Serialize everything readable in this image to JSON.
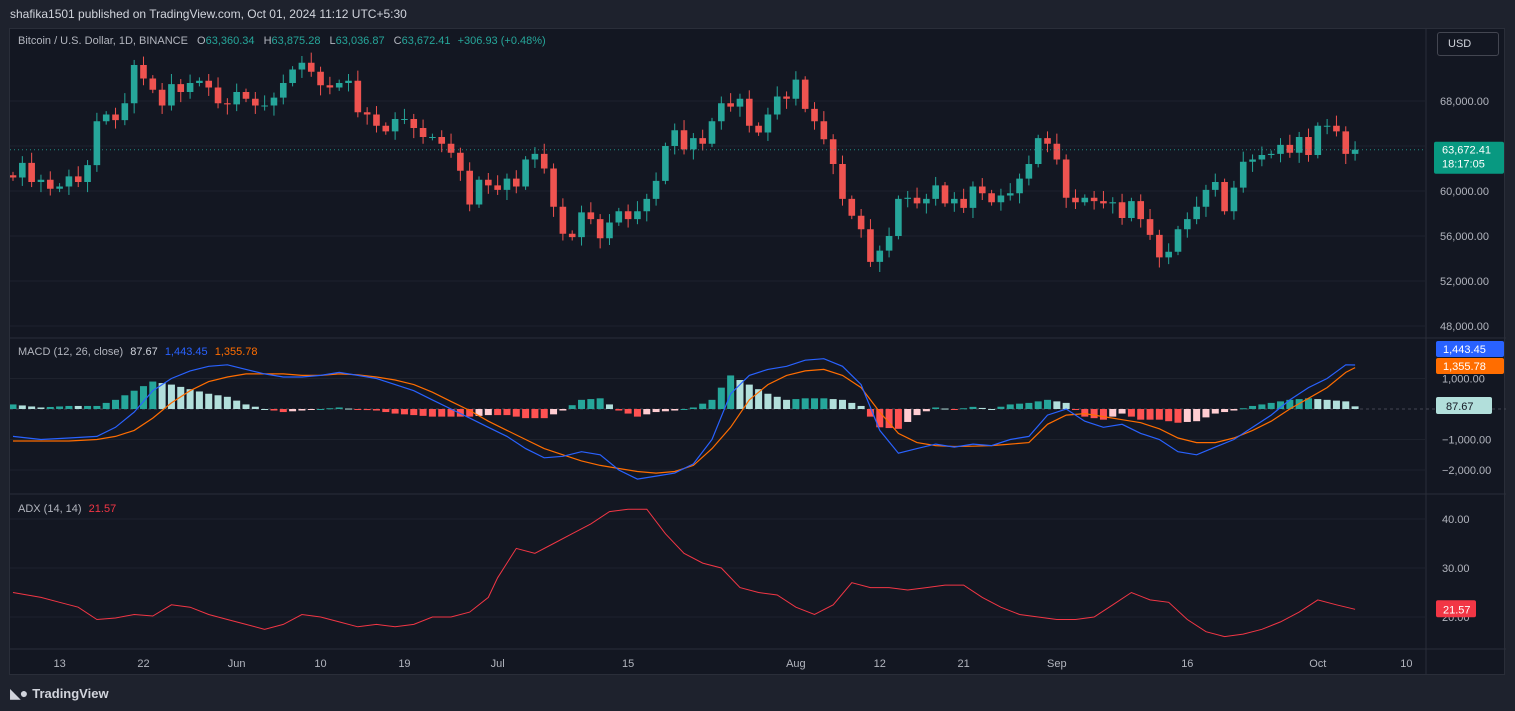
{
  "header": {
    "published_line": "shafika1501 published on TradingView.com, Oct 01, 2024 11:12 UTC+5:30"
  },
  "legend": {
    "symbol": "Bitcoin / U.S. Dollar, 1D, BINANCE",
    "open_label": "O",
    "open": "63,360.34",
    "high_label": "H",
    "high": "63,875.28",
    "low_label": "L",
    "low": "63,036.87",
    "close_label": "C",
    "close": "63,672.41",
    "change": "+306.93 (+0.48%)"
  },
  "currency_button": "USD",
  "price_axis": {
    "ticks": [
      "68,000.00",
      "64,000.00",
      "60,000.00",
      "56,000.00",
      "52,000.00",
      "48,000.00"
    ],
    "last_price": "63,672.41",
    "countdown": "18:17:05",
    "last_price_color": "#089981"
  },
  "macd": {
    "label": "MACD (12, 26, close)",
    "histogram": "87.67",
    "macd": "1,443.45",
    "signal": "1,355.78",
    "ticks": [
      "1,000.00",
      "0.00",
      "−1,000.00",
      "−2,000.00"
    ],
    "macd_color": "#2962ff",
    "signal_color": "#ff6d00"
  },
  "adx": {
    "label": "ADX (14, 14)",
    "value": "21.57",
    "ticks": [
      "40.00",
      "30.00",
      "20.00"
    ],
    "color": "#f23645"
  },
  "time_axis": {
    "labels": [
      "13",
      "22",
      "Jun",
      "10",
      "19",
      "Jul",
      "15",
      "Aug",
      "12",
      "21",
      "Sep",
      "16",
      "Oct",
      "10"
    ]
  },
  "colors": {
    "up": "#26a69a",
    "down": "#ef5350",
    "background": "#131722"
  },
  "footer": {
    "brand": "TradingView",
    "logo_icon": "tradingview-logo-icon"
  },
  "chart_data": [
    {
      "type": "candlestick",
      "title": "Bitcoin / U.S. Dollar, 1D, BINANCE",
      "ylim": [
        46000,
        72000
      ],
      "closes": [
        61200,
        62500,
        60800,
        61000,
        60200,
        60400,
        61300,
        60800,
        62300,
        66200,
        66800,
        66300,
        67800,
        71200,
        70000,
        69000,
        67600,
        69500,
        68800,
        69600,
        69800,
        69200,
        67800,
        67700,
        68800,
        68200,
        67600,
        67600,
        68300,
        69600,
        70800,
        71400,
        70600,
        69400,
        69200,
        69600,
        69800,
        67000,
        66800,
        65800,
        65300,
        66400,
        66400,
        65600,
        64800,
        64800,
        64200,
        63400,
        61800,
        58800,
        61000,
        60500,
        60100,
        61100,
        60400,
        62800,
        63300,
        62000,
        58600,
        56200,
        55900,
        58100,
        57500,
        55800,
        57200,
        58200,
        57500,
        58200,
        59300,
        60900,
        64000,
        65400,
        63700,
        64700,
        64200,
        66200,
        67800,
        67500,
        68200,
        65800,
        65200,
        66800,
        68400,
        68200,
        69900,
        67300,
        66200,
        64600,
        62400,
        59300,
        57800,
        56600,
        53700,
        54700,
        56000,
        59300,
        59400,
        58900,
        59300,
        60500,
        58900,
        59300,
        58500,
        60400,
        59800,
        59000,
        59600,
        59800,
        61100,
        62400,
        64700,
        64200,
        62800,
        59400,
        59000,
        59400,
        59100,
        58900,
        59000,
        57600,
        59100,
        57500,
        56100,
        54100,
        54600,
        56600,
        57500,
        58600,
        60100,
        60800,
        58200,
        60300,
        62600,
        62800,
        63200,
        63300,
        64100,
        63400,
        64800,
        63200,
        65800,
        65800,
        65300,
        63300,
        63672
      ]
    },
    {
      "type": "line",
      "title": "MACD (12, 26, close)",
      "ylim": [
        -2900,
        2000
      ],
      "series": [
        {
          "name": "MACD",
          "x": [
            0,
            3,
            6,
            9,
            11,
            13,
            15,
            17,
            19,
            21,
            23,
            25,
            27,
            29,
            31,
            33,
            35,
            37,
            39,
            41,
            43,
            45,
            47,
            49,
            51,
            53,
            55,
            57,
            59,
            61,
            63,
            65,
            67,
            69,
            71,
            73,
            75,
            77,
            79,
            81,
            83,
            85,
            87,
            89,
            91,
            93,
            95,
            97,
            99,
            101,
            103,
            105,
            107,
            109,
            111,
            113,
            115,
            117,
            119,
            121,
            123,
            125,
            127,
            129,
            131,
            133,
            135,
            137,
            139,
            141,
            143,
            144
          ],
          "values": [
            -900,
            -1000,
            -950,
            -900,
            -600,
            -100,
            600,
            1000,
            1250,
            1400,
            1450,
            1300,
            1150,
            1050,
            1050,
            1100,
            1200,
            1100,
            1000,
            800,
            600,
            300,
            0,
            -300,
            -600,
            -900,
            -1300,
            -1600,
            -1550,
            -1400,
            -1500,
            -2000,
            -2300,
            -2200,
            -2100,
            -1800,
            -1000,
            500,
            1100,
            1300,
            1400,
            1600,
            1650,
            1400,
            800,
            -700,
            -1450,
            -1300,
            -1150,
            -1250,
            -1150,
            -1200,
            -1000,
            -900,
            -200,
            0,
            -400,
            -600,
            -500,
            -800,
            -1000,
            -1400,
            -1500,
            -1250,
            -1000,
            -600,
            -200,
            300,
            700,
            1000,
            1450,
            1443
          ]
        },
        {
          "name": "Signal",
          "x": [
            0,
            3,
            6,
            9,
            11,
            13,
            15,
            17,
            19,
            21,
            23,
            25,
            27,
            29,
            31,
            33,
            35,
            37,
            39,
            41,
            43,
            45,
            47,
            49,
            51,
            53,
            55,
            57,
            59,
            61,
            63,
            65,
            67,
            69,
            71,
            73,
            75,
            77,
            79,
            81,
            83,
            85,
            87,
            89,
            91,
            93,
            95,
            97,
            99,
            101,
            103,
            105,
            107,
            109,
            111,
            113,
            115,
            117,
            119,
            121,
            123,
            125,
            127,
            129,
            131,
            133,
            135,
            137,
            139,
            141,
            143,
            144
          ],
          "values": [
            -1050,
            -1050,
            -1050,
            -1000,
            -900,
            -700,
            -300,
            200,
            600,
            900,
            1050,
            1150,
            1150,
            1150,
            1100,
            1100,
            1150,
            1120,
            1050,
            950,
            800,
            550,
            250,
            -50,
            -400,
            -700,
            -1000,
            -1300,
            -1500,
            -1700,
            -1850,
            -1950,
            -2050,
            -2100,
            -2050,
            -1850,
            -1300,
            -600,
            300,
            800,
            1100,
            1250,
            1300,
            1100,
            700,
            -100,
            -800,
            -1100,
            -1200,
            -1230,
            -1220,
            -1200,
            -1150,
            -1100,
            -500,
            -200,
            -150,
            -250,
            -350,
            -450,
            -650,
            -950,
            -1100,
            -1100,
            -950,
            -700,
            -400,
            0,
            350,
            700,
            1200,
            1356
          ]
        }
      ]
    },
    {
      "type": "line",
      "title": "ADX (14, 14)",
      "ylim": [
        15,
        45
      ],
      "series": [
        {
          "name": "ADX",
          "x": [
            0,
            3,
            5,
            7,
            9,
            11,
            13,
            15,
            17,
            19,
            21,
            23,
            25,
            27,
            29,
            31,
            33,
            35,
            37,
            39,
            41,
            43,
            45,
            47,
            49,
            51,
            52,
            54,
            56,
            58,
            60,
            62,
            64,
            66,
            68,
            70,
            72,
            74,
            76,
            78,
            80,
            82,
            84,
            86,
            88,
            90,
            92,
            94,
            96,
            98,
            100,
            102,
            104,
            106,
            108,
            110,
            112,
            114,
            116,
            118,
            120,
            122,
            124,
            126,
            128,
            130,
            132,
            134,
            136,
            138,
            140,
            142,
            144
          ],
          "values": [
            25,
            24,
            23,
            22,
            19.5,
            19.8,
            20.5,
            20.2,
            22.5,
            22,
            20.5,
            19.5,
            18.5,
            17.5,
            18.5,
            20.5,
            20,
            19,
            18,
            18.5,
            18,
            18.5,
            20,
            20,
            21,
            24,
            28,
            34,
            33,
            35,
            37,
            39,
            41.5,
            42,
            42,
            37,
            33,
            31,
            30,
            26,
            25,
            24.5,
            22,
            20.5,
            22.5,
            27,
            26,
            26,
            25.5,
            26,
            26.5,
            26.5,
            24,
            22,
            20.5,
            20,
            19.5,
            19.5,
            20,
            22.5,
            25,
            23.5,
            23,
            19.5,
            17,
            16,
            16.5,
            17.5,
            19,
            21,
            23.5,
            22.5,
            21.57
          ]
        }
      ]
    }
  ]
}
